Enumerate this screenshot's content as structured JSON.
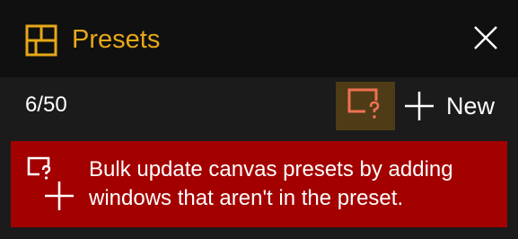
{
  "header": {
    "title": "Presets",
    "icon": "presets-grid-icon",
    "close_icon": "close-icon",
    "accent_color": "#e6a817"
  },
  "toolbar": {
    "count": "6/50",
    "bulk_update_icon": "canvas-question-icon",
    "new_label": "New",
    "new_icon": "plus-icon"
  },
  "banner": {
    "icon": "canvas-question-add-icon",
    "message": "Bulk update canvas presets by adding windows that aren't in the preset.",
    "background_color": "#a30000"
  }
}
